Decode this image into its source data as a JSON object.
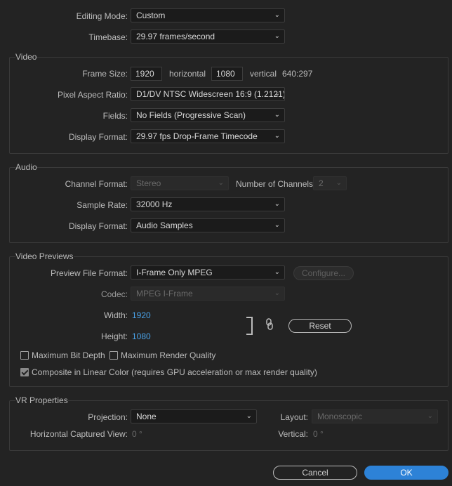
{
  "top": {
    "editing_mode_label": "Editing Mode:",
    "editing_mode_value": "Custom",
    "timebase_label": "Timebase:",
    "timebase_value": "29.97  frames/second"
  },
  "video": {
    "title": "Video",
    "frame_size_label": "Frame Size:",
    "frame_width": "1920",
    "horizontal_label": "horizontal",
    "frame_height": "1080",
    "vertical_label": "vertical",
    "ratio": "640:297",
    "par_label": "Pixel Aspect Ratio:",
    "par_value": "D1/DV NTSC Widescreen 16:9 (1.2121)",
    "fields_label": "Fields:",
    "fields_value": "No Fields (Progressive Scan)",
    "display_format_label": "Display Format:",
    "display_format_value": "29.97 fps Drop-Frame Timecode"
  },
  "audio": {
    "title": "Audio",
    "channel_format_label": "Channel Format:",
    "channel_format_value": "Stereo",
    "num_channels_label": "Number of Channels:",
    "num_channels_value": "2",
    "sample_rate_label": "Sample Rate:",
    "sample_rate_value": "32000 Hz",
    "display_format_label": "Display Format:",
    "display_format_value": "Audio Samples"
  },
  "previews": {
    "title": "Video Previews",
    "file_format_label": "Preview File Format:",
    "file_format_value": "I-Frame Only MPEG",
    "configure_label": "Configure...",
    "codec_label": "Codec:",
    "codec_value": "MPEG I-Frame",
    "width_label": "Width:",
    "width_value": "1920",
    "height_label": "Height:",
    "height_value": "1080",
    "reset_label": "Reset",
    "max_bit_depth_label": "Maximum Bit Depth",
    "max_render_quality_label": "Maximum Render Quality",
    "composite_label": "Composite in Linear Color (requires GPU acceleration or max render quality)"
  },
  "vr": {
    "title": "VR Properties",
    "projection_label": "Projection:",
    "projection_value": "None",
    "layout_label": "Layout:",
    "layout_value": "Monoscopic",
    "hview_label": "Horizontal Captured View:",
    "hview_value": "0 °",
    "vertical_label": "Vertical:",
    "vertical_value": "0 °"
  },
  "footer": {
    "cancel_label": "Cancel",
    "ok_label": "OK"
  }
}
